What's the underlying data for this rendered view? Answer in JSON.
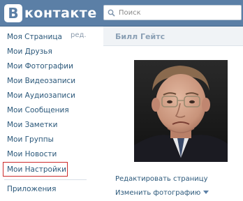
{
  "header": {
    "logo_letter": "В",
    "logo_text": "контакте",
    "search_placeholder": "Поиск"
  },
  "sidebar": {
    "edit_label": "ред.",
    "items": [
      {
        "label": "Моя Страница"
      },
      {
        "label": "Мои Друзья"
      },
      {
        "label": "Мои Фотографии"
      },
      {
        "label": "Мои Видеозаписи"
      },
      {
        "label": "Мои Аудиозаписи"
      },
      {
        "label": "Мои Сообщения"
      },
      {
        "label": "Мои Заметки"
      },
      {
        "label": "Мои Группы"
      },
      {
        "label": "Мои Новости"
      },
      {
        "label": "Мои Настройки"
      },
      {
        "label": "Приложения"
      }
    ],
    "highlighted_item": "Мои Настройки"
  },
  "profile": {
    "name": "Билл Гейтс",
    "edit_page_label": "Редактировать страницу",
    "change_photo_label": "Изменить фотографию"
  },
  "colors": {
    "header_bg": "#5b7fa6",
    "link": "#2b587a",
    "highlight_border": "#cc2b2b"
  }
}
